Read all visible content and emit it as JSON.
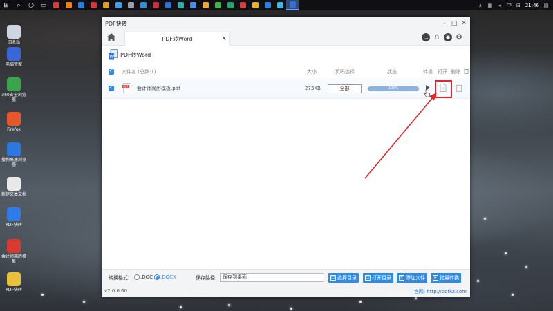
{
  "taskbar": {
    "apps": [
      {
        "name": "app-red",
        "color": "#e0383e"
      },
      {
        "name": "app-orange",
        "color": "#ef7f1a"
      },
      {
        "name": "app-blue",
        "color": "#2a7de1"
      },
      {
        "name": "app-red-2",
        "color": "#d9343a"
      },
      {
        "name": "app-chrome",
        "color": "#e0a21e"
      },
      {
        "name": "app-blue-2",
        "color": "#3da0ee"
      },
      {
        "name": "app-gray",
        "color": "#9aa3ad"
      },
      {
        "name": "app-mail",
        "color": "#2d8fd8"
      },
      {
        "name": "app-red-3",
        "color": "#c8323a"
      },
      {
        "name": "app-blue-3",
        "color": "#2f6fd9"
      },
      {
        "name": "app-teal",
        "color": "#2bb0a7"
      },
      {
        "name": "app-blue-4",
        "color": "#4a8de8"
      },
      {
        "name": "app-orange-2",
        "color": "#f0a83a"
      },
      {
        "name": "app-green",
        "color": "#3fb34a"
      },
      {
        "name": "app-green-2",
        "color": "#23a566"
      },
      {
        "name": "app-red-4",
        "color": "#d8403a"
      },
      {
        "name": "app-yellow",
        "color": "#e8b52a"
      },
      {
        "name": "app-blue-5",
        "color": "#2d7fe0"
      },
      {
        "name": "app-cyan",
        "color": "#3bb7e6"
      },
      {
        "name": "app-pdf",
        "color": "#2f6fe0"
      }
    ],
    "ime": "中",
    "time": "21:46"
  },
  "desktop_icons": [
    {
      "label": "回收站",
      "color": "#cfd6df"
    },
    {
      "label": "电脑管家",
      "color": "#3a67d8"
    },
    {
      "label": "360安全浏览器",
      "color": "#3aa54a"
    },
    {
      "label": "Firefox",
      "color": "#e8572a"
    },
    {
      "label": "搜狗高速浏览器",
      "color": "#2a78e0"
    },
    {
      "label": "新建文本文档",
      "color": "#e8e8e8"
    },
    {
      "label": "PDF快转",
      "color": "#2f7ce8"
    },
    {
      "label": "会计师简历模板",
      "color": "#d63a30"
    },
    {
      "label": "PDF快转",
      "color": "#e8c03a"
    }
  ],
  "window": {
    "title": "PDF快转",
    "tab_label": "PDF转Word",
    "tab_close": "×",
    "section_title": "PDF转Word",
    "header": {
      "filename": "文件名 (总数:1)",
      "size": "大小",
      "pages": "页码选择",
      "status": "状态",
      "convert": "转换",
      "open": "打开",
      "delete": "删除"
    },
    "row": {
      "filename": "会计师简历模板.pdf",
      "size": "273KB",
      "pages": "全部",
      "progress_label": "100%",
      "progress": 1.0
    },
    "bottom": {
      "format_label": "转换格式:",
      "format_doc": ".DOC",
      "format_docx": ".DOCX",
      "save_label": "保存路径:",
      "save_value": "保存到桌面",
      "choose_dir": "选择目录",
      "open_dir": "打开目录",
      "add_file": "添加文件",
      "batch_convert": "批量转换"
    },
    "version": "v2.0.6.60",
    "site": "官网: http://pdfkz.com"
  },
  "colors": {
    "accent": "#2e8ae6",
    "highlight_box": "#e0272a",
    "progress_fill": "#8fb2dd"
  }
}
